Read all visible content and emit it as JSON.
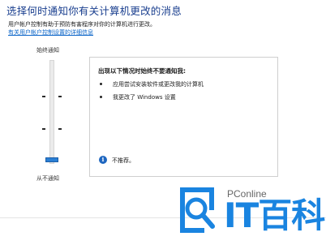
{
  "header": {
    "title": "选择何时通知你有关计算机更改的消息",
    "description": "用户帐户控制有助于预防有害程序对你的计算机进行更改。",
    "link": "有关用户帐户控制设置的详细信息"
  },
  "slider": {
    "top_label": "始终通知",
    "bottom_label": "从不通知",
    "level": 0,
    "levels": 4
  },
  "panel": {
    "heading": "出现以下情况时始终不要通知我:",
    "items": [
      "应用尝试安装软件或更改我的计算机",
      "我更改了 Windows 设置"
    ],
    "recommendation": "不推荐。"
  },
  "watermark": {
    "brand": "PConline",
    "name": "IT百科",
    "accent": "#1a84e0"
  }
}
